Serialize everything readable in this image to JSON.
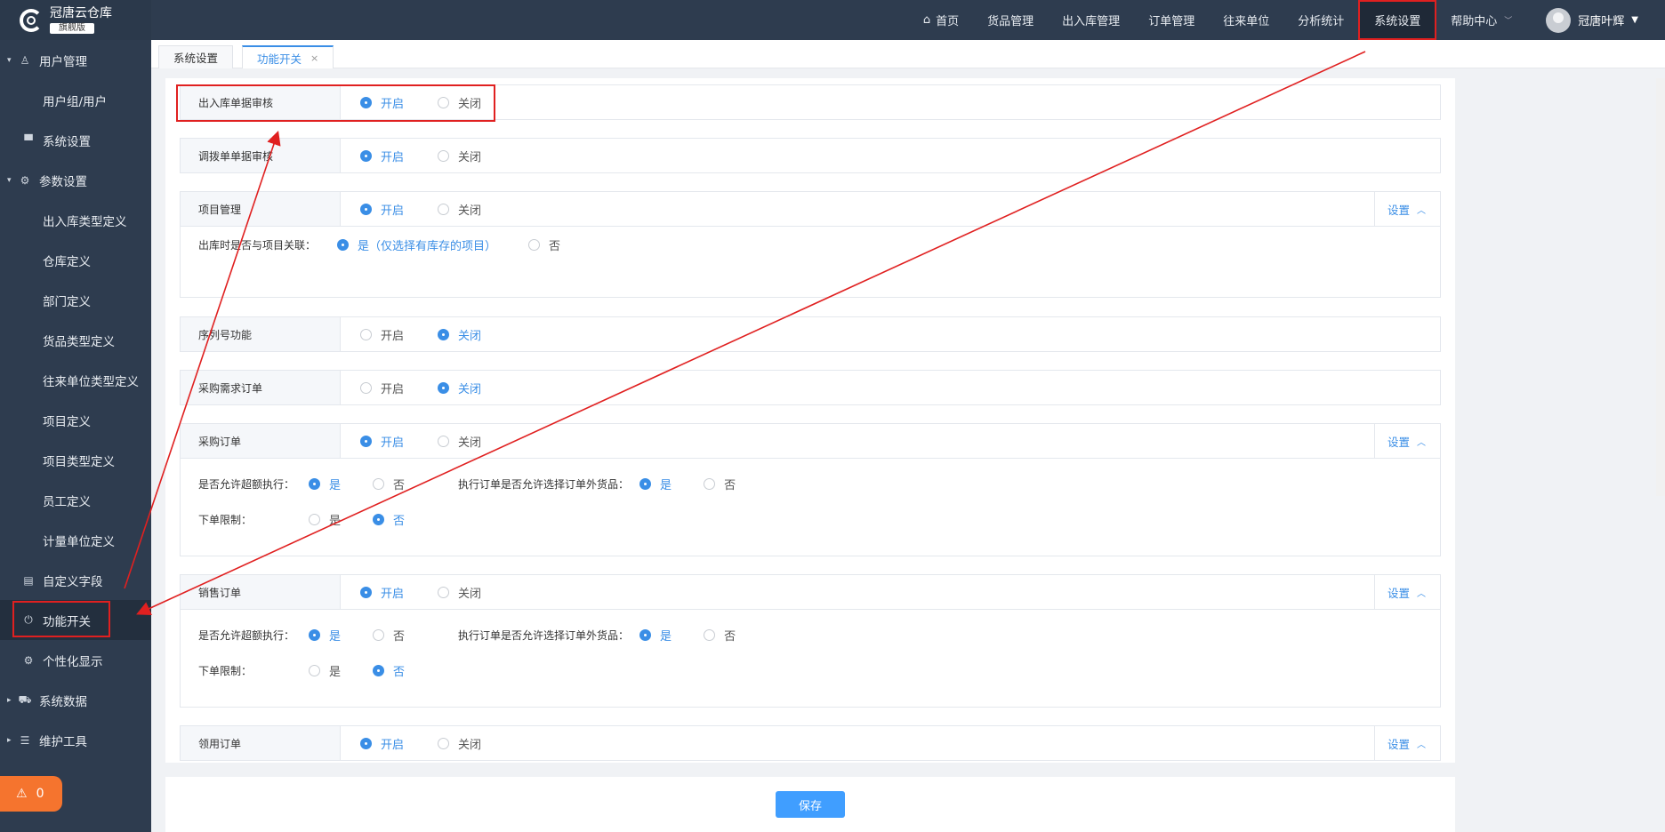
{
  "logo": {
    "name": "冠唐云仓库",
    "badge": "旗舰版"
  },
  "sidebar": {
    "items": [
      {
        "label": "用户管理",
        "icon": "user-icon",
        "level": 1,
        "expanded": true
      },
      {
        "label": "用户组/用户",
        "level": 2
      },
      {
        "label": "系统设置",
        "icon": "monitor-icon",
        "level": 1
      },
      {
        "label": "参数设置",
        "icon": "gear-icon",
        "level": 1,
        "expanded": true
      },
      {
        "label": "出入库类型定义",
        "level": 2
      },
      {
        "label": "仓库定义",
        "level": 2
      },
      {
        "label": "部门定义",
        "level": 2
      },
      {
        "label": "货品类型定义",
        "level": 2
      },
      {
        "label": "往来单位类型定义",
        "level": 2
      },
      {
        "label": "项目定义",
        "level": 2
      },
      {
        "label": "项目类型定义",
        "level": 2
      },
      {
        "label": "员工定义",
        "level": 2
      },
      {
        "label": "计量单位定义",
        "level": 2
      },
      {
        "label": "自定义字段",
        "icon": "save-icon",
        "level": 1
      },
      {
        "label": "功能开关",
        "icon": "power-icon",
        "level": 1,
        "active": true
      },
      {
        "label": "个性化显示",
        "icon": "gear-icon",
        "level": 1
      },
      {
        "label": "系统数据",
        "icon": "cart-icon",
        "level": 1,
        "collapsed": true
      },
      {
        "label": "维护工具",
        "icon": "database-icon",
        "level": 1,
        "collapsed": true
      }
    ],
    "alarm_count": "0"
  },
  "topnav": {
    "items": [
      "首页",
      "货品管理",
      "出入库管理",
      "订单管理",
      "往来单位",
      "分析统计",
      "系统设置",
      "帮助中心"
    ],
    "active": "系统设置",
    "user": "冠唐叶辉"
  },
  "tabs": [
    {
      "label": "系统设置",
      "active": false
    },
    {
      "label": "功能开关",
      "active": true,
      "close": "×"
    }
  ],
  "labels": {
    "on": "开启",
    "off": "关闭",
    "yes": "是",
    "no": "否",
    "setting": "设置"
  },
  "blocks": [
    {
      "label": "出入库单据审核",
      "value": "开启"
    },
    {
      "label": "调拨单单据审核",
      "value": "开启"
    },
    {
      "label": "项目管理",
      "value": "开启",
      "sub": [
        {
          "q": "出库时是否与项目关联：",
          "yes": "是（仅选择有库存的项目）",
          "no": "否",
          "value": "yes"
        }
      ]
    },
    {
      "label": "序列号功能",
      "value": "关闭"
    },
    {
      "label": "采购需求订单",
      "value": "关闭"
    },
    {
      "label": "采购订单",
      "value": "开启",
      "sub": [
        {
          "q": "是否允许超额执行：",
          "value": "yes",
          "q2": "执行订单是否允许选择订单外货品：",
          "value2": "yes"
        },
        {
          "q": "下单限制：",
          "value": "no"
        }
      ]
    },
    {
      "label": "销售订单",
      "value": "开启",
      "sub": [
        {
          "q": "是否允许超额执行：",
          "value": "yes",
          "q2": "执行订单是否允许选择订单外货品：",
          "value2": "yes"
        },
        {
          "q": "下单限制：",
          "value": "no"
        }
      ]
    },
    {
      "label": "领用订单",
      "value": "开启"
    }
  ],
  "footer": {
    "save": "保存"
  },
  "colors": {
    "sidebar": "#2e3c4f",
    "accent": "#409eff",
    "annotation": "#e02020",
    "alarm": "#f5742e"
  }
}
